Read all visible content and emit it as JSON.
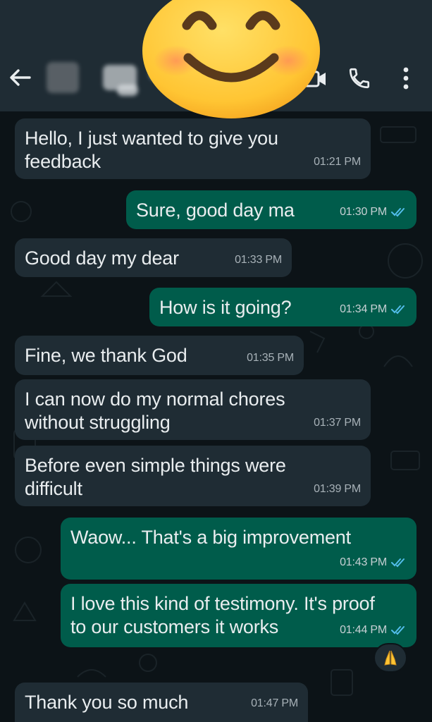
{
  "header": {
    "back_icon": "arrow-left-icon",
    "video_icon": "video-call-icon",
    "call_icon": "phone-icon",
    "menu_icon": "more-vertical-icon",
    "overlay_emoji": "smiling-face-emoji"
  },
  "messages": [
    {
      "direction": "in",
      "lines": [
        "Hello, I just wanted to give you",
        "feedback"
      ],
      "time": "01:21 PM"
    },
    {
      "direction": "out",
      "lines": [
        "Sure, good day ma"
      ],
      "time": "01:30 PM",
      "status": "read"
    },
    {
      "direction": "in",
      "lines": [
        "Good day my dear"
      ],
      "time": "01:33 PM"
    },
    {
      "direction": "out",
      "lines": [
        "How is it going?"
      ],
      "time": "01:34 PM",
      "status": "read"
    },
    {
      "direction": "in",
      "lines": [
        "Fine, we thank God"
      ],
      "time": "01:35 PM"
    },
    {
      "direction": "in",
      "lines": [
        "I can now do my normal chores",
        "without struggling"
      ],
      "time": "01:37 PM"
    },
    {
      "direction": "in",
      "lines": [
        "Before even simple things were",
        "difficult"
      ],
      "time": "01:39 PM"
    },
    {
      "direction": "out",
      "lines": [
        "Waow... That's a big improvement"
      ],
      "time": "01:43 PM",
      "status": "read"
    },
    {
      "direction": "out",
      "lines": [
        "I love this kind of testimony. It's proof",
        "to our customers it works"
      ],
      "time": "01:44 PM",
      "status": "read",
      "reaction": "folded-hands-emoji"
    },
    {
      "direction": "in",
      "lines": [
        "Thank you so much"
      ],
      "time": "01:47 PM"
    }
  ],
  "colors": {
    "background": "#0c1317",
    "header": "#1f2c34",
    "incoming_bubble": "#1f2c34",
    "outgoing_bubble": "#005c4b",
    "read_ticks": "#53bdeb"
  }
}
